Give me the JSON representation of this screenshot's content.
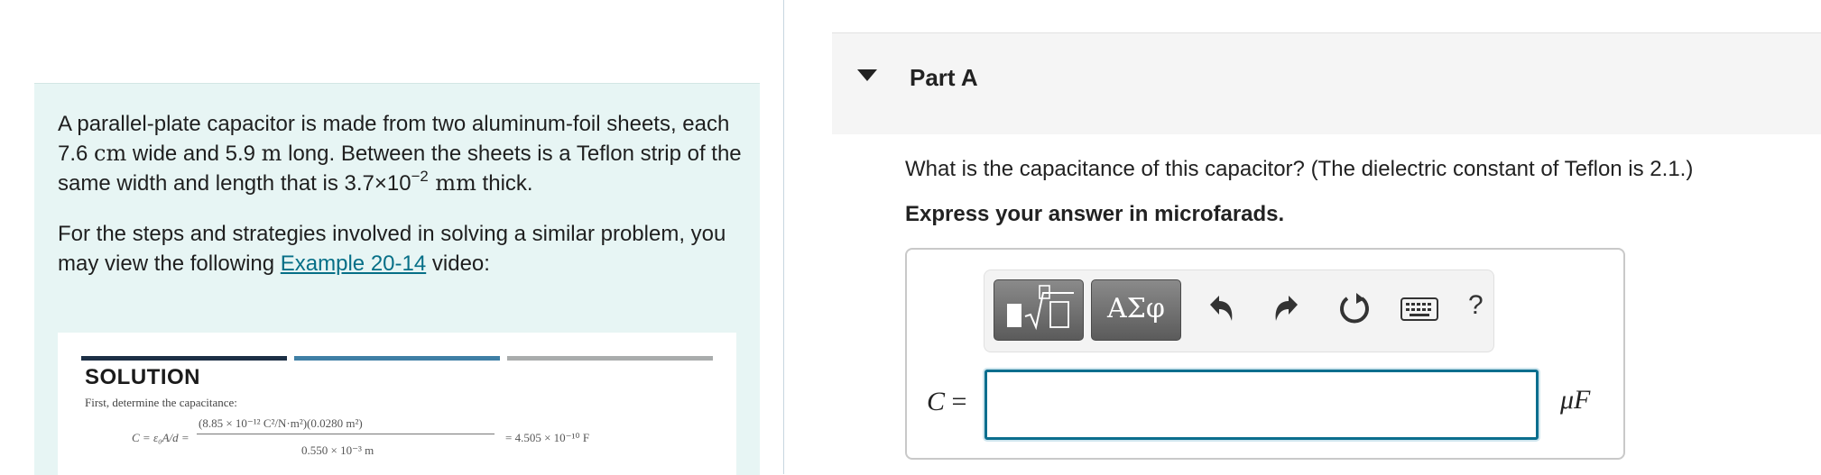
{
  "problem": {
    "para1_a": "A parallel-plate capacitor is made from two aluminum-foil sheets, each 7.6 ",
    "unit_cm": "cm",
    "para1_b": " wide and 5.9 ",
    "unit_m": "m",
    "para1_c": " long. Between the sheets is a Teflon strip of the same width and length that is 3.7×10",
    "exponent": "−2",
    "unit_mm": " mm",
    "para1_d": " thick.",
    "para2_a": "For the steps and strategies involved in solving a similar problem, you may view the following ",
    "link_text": "Example 20-14",
    "para2_b": " video:"
  },
  "solution_preview": {
    "heading": "SOLUTION",
    "first_line": "First, determine the capacitance:",
    "lhs": "C = ε₀A/d =",
    "numerator": "(8.85 × 10⁻¹² C²/N·m²)(0.0280 m²)",
    "denominator": "0.550 × 10⁻³ m",
    "result": "= 4.505 × 10⁻¹⁰ F"
  },
  "part": {
    "title": "Part A"
  },
  "question": "What is the capacitance of this capacitor? (The dielectric constant of Teflon is 2.1.)",
  "instruction": "Express your answer in microfarads.",
  "toolbar": {
    "symbols_label": "ΑΣφ",
    "help_label": "?"
  },
  "answer": {
    "variable": "C",
    "equals": " =",
    "value": "",
    "unit": "μF"
  },
  "colors": {
    "link": "#066f87",
    "panel_bg": "#e7f5f4",
    "input_border": "#0b6e8e"
  }
}
